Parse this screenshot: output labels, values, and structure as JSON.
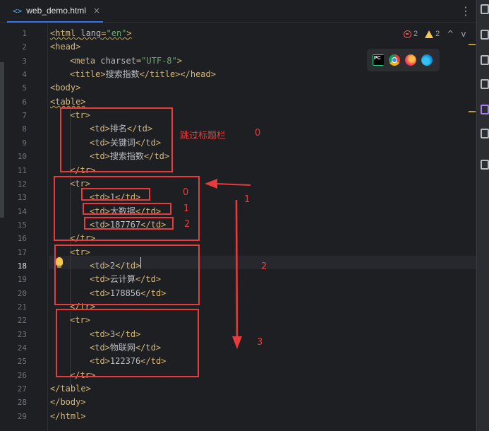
{
  "tab": {
    "icon": "<>",
    "filename": "web_demo.html",
    "close_glyph": "×"
  },
  "tab_menu_glyph": "⋮",
  "inspections": {
    "errors": "2",
    "warnings": "2",
    "up": "^",
    "down": "v"
  },
  "browsers": [
    "pycharm-icon",
    "chrome-icon",
    "firefox-icon",
    "edge-icon"
  ],
  "right_strip_icons": [
    "notifications-icon",
    "ai-assistant-icon",
    "database-icon",
    "structure-icon",
    "plugin-icon",
    "python-icon",
    "services-icon"
  ],
  "current_line": 18,
  "code_lines": [
    {
      "n": "1",
      "indent": 0,
      "parts": [
        [
          "tag",
          "<html "
        ],
        [
          "attr",
          "lang"
        ],
        [
          "tag",
          "="
        ],
        [
          "str",
          "\"en\""
        ],
        [
          "tag",
          ">"
        ]
      ],
      "squiggle": true
    },
    {
      "n": "2",
      "indent": 0,
      "parts": [
        [
          "tag",
          "<head>"
        ]
      ]
    },
    {
      "n": "3",
      "indent": 1,
      "parts": [
        [
          "tag",
          "<meta "
        ],
        [
          "attr",
          "charset"
        ],
        [
          "tag",
          "="
        ],
        [
          "str",
          "\"UTF-8\""
        ],
        [
          "tag",
          ">"
        ]
      ]
    },
    {
      "n": "4",
      "indent": 1,
      "parts": [
        [
          "tag",
          "<title>"
        ],
        [
          "txt",
          "搜索指数"
        ],
        [
          "tag",
          "</title></head>"
        ]
      ]
    },
    {
      "n": "5",
      "indent": 0,
      "parts": [
        [
          "tag",
          "<body>"
        ]
      ]
    },
    {
      "n": "6",
      "indent": 0,
      "parts": [
        [
          "tag",
          "<table>"
        ]
      ],
      "squiggle": true
    },
    {
      "n": "7",
      "indent": 1,
      "parts": [
        [
          "tag",
          "<tr>"
        ]
      ]
    },
    {
      "n": "8",
      "indent": 2,
      "parts": [
        [
          "tag",
          "<td>"
        ],
        [
          "txt",
          "排名"
        ],
        [
          "tag",
          "</td>"
        ]
      ]
    },
    {
      "n": "9",
      "indent": 2,
      "parts": [
        [
          "tag",
          "<td>"
        ],
        [
          "txt",
          "关键词"
        ],
        [
          "tag",
          "</td>"
        ]
      ]
    },
    {
      "n": "10",
      "indent": 2,
      "parts": [
        [
          "tag",
          "<td>"
        ],
        [
          "txt",
          "搜索指数"
        ],
        [
          "tag",
          "</td>"
        ]
      ]
    },
    {
      "n": "11",
      "indent": 1,
      "parts": [
        [
          "tag",
          "</tr>"
        ]
      ]
    },
    {
      "n": "12",
      "indent": 1,
      "parts": [
        [
          "tag",
          "<tr>"
        ]
      ]
    },
    {
      "n": "13",
      "indent": 2,
      "parts": [
        [
          "tag",
          "<td>"
        ],
        [
          "txt",
          "1"
        ],
        [
          "tag",
          "</td>"
        ]
      ]
    },
    {
      "n": "14",
      "indent": 2,
      "parts": [
        [
          "tag",
          "<td>"
        ],
        [
          "txt",
          "大数据"
        ],
        [
          "tag",
          "</td>"
        ]
      ]
    },
    {
      "n": "15",
      "indent": 2,
      "parts": [
        [
          "tag",
          "<td>"
        ],
        [
          "txt",
          "187767"
        ],
        [
          "tag",
          "</td>"
        ]
      ]
    },
    {
      "n": "16",
      "indent": 1,
      "parts": [
        [
          "tag",
          "</tr>"
        ]
      ]
    },
    {
      "n": "17",
      "indent": 1,
      "parts": [
        [
          "tag",
          "<tr>"
        ]
      ]
    },
    {
      "n": "18",
      "indent": 2,
      "parts": [
        [
          "tag",
          "<td>"
        ],
        [
          "txt",
          "2"
        ],
        [
          "tag",
          "</td>"
        ]
      ]
    },
    {
      "n": "19",
      "indent": 2,
      "parts": [
        [
          "tag",
          "<td>"
        ],
        [
          "txt",
          "云计算"
        ],
        [
          "tag",
          "</td>"
        ]
      ]
    },
    {
      "n": "20",
      "indent": 2,
      "parts": [
        [
          "tag",
          "<td>"
        ],
        [
          "txt",
          "178856"
        ],
        [
          "tag",
          "</td>"
        ]
      ]
    },
    {
      "n": "21",
      "indent": 1,
      "parts": [
        [
          "tag",
          "</tr>"
        ]
      ]
    },
    {
      "n": "22",
      "indent": 1,
      "parts": [
        [
          "tag",
          "<tr>"
        ]
      ]
    },
    {
      "n": "23",
      "indent": 2,
      "parts": [
        [
          "tag",
          "<td>"
        ],
        [
          "txt",
          "3"
        ],
        [
          "tag",
          "</td>"
        ]
      ]
    },
    {
      "n": "24",
      "indent": 2,
      "parts": [
        [
          "tag",
          "<td>"
        ],
        [
          "txt",
          "物联网"
        ],
        [
          "tag",
          "</td>"
        ]
      ]
    },
    {
      "n": "25",
      "indent": 2,
      "parts": [
        [
          "tag",
          "<td>"
        ],
        [
          "txt",
          "122376"
        ],
        [
          "tag",
          "</td>"
        ]
      ]
    },
    {
      "n": "26",
      "indent": 1,
      "parts": [
        [
          "tag",
          "</tr>"
        ]
      ]
    },
    {
      "n": "27",
      "indent": 0,
      "parts": [
        [
          "tag",
          "</table>"
        ]
      ]
    },
    {
      "n": "28",
      "indent": 0,
      "parts": [
        [
          "tag",
          "</body>"
        ]
      ]
    },
    {
      "n": "29",
      "indent": 0,
      "parts": [
        [
          "tag",
          "</html>"
        ]
      ]
    }
  ],
  "annotations": {
    "header_note": "跳过标题栏",
    "header_index": "0",
    "cell_index_0": "0",
    "cell_index_1": "1",
    "cell_index_2": "2",
    "row_index_1": "1",
    "row_index_2": "2",
    "row_index_3": "3",
    "color": "#e83b3b"
  }
}
